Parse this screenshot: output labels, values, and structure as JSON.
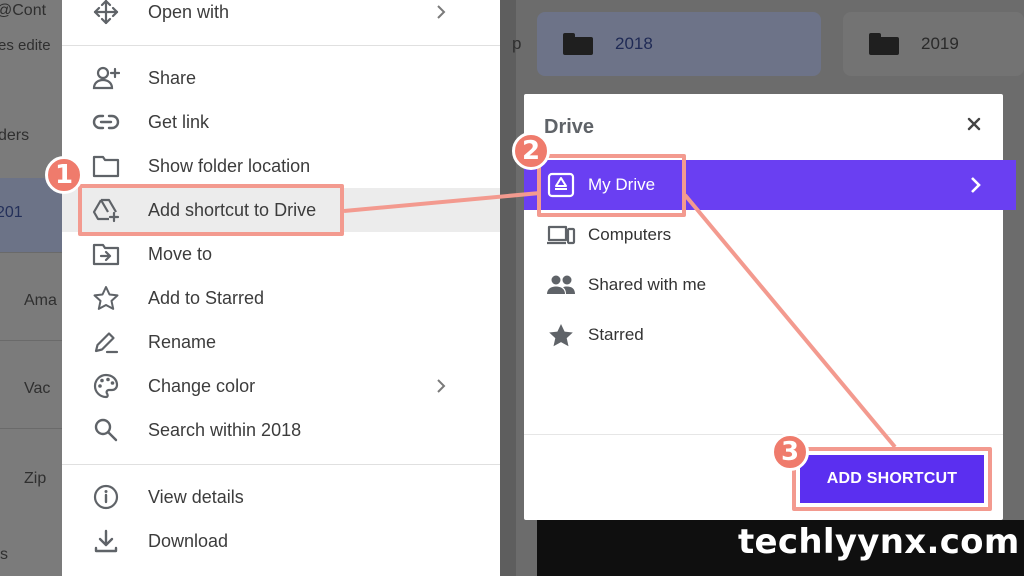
{
  "background": {
    "left_fragments": [
      {
        "name": "owner-fragment",
        "text": "@Cont"
      },
      {
        "name": "edited-fragment",
        "text": "es edite"
      },
      {
        "name": "folders-fragment",
        "text": "ders"
      },
      {
        "name": "folder-2018-fragment",
        "text": "201"
      },
      {
        "name": "folder-ama-fragment",
        "text": "Ama"
      },
      {
        "name": "folder-vac-fragment",
        "text": "Vac"
      },
      {
        "name": "folder-zip-fragment",
        "text": "Zip"
      },
      {
        "name": "bottom-fragment",
        "text": "s"
      }
    ],
    "cards": [
      {
        "label": "2018"
      },
      {
        "label": "2019"
      }
    ],
    "top_fragment": "p"
  },
  "context_menu": {
    "items": [
      {
        "label": "Open with",
        "icon": "move-arrows-icon",
        "submenu": true
      },
      {
        "label": "Share",
        "icon": "person-add-icon",
        "submenu": false
      },
      {
        "label": "Get link",
        "icon": "link-icon",
        "submenu": false
      },
      {
        "label": "Show folder location",
        "icon": "folder-outline-icon",
        "submenu": false
      },
      {
        "label": "Add shortcut to Drive",
        "icon": "drive-add-icon",
        "submenu": false,
        "highlighted": true
      },
      {
        "label": "Move to",
        "icon": "move-to-icon",
        "submenu": false
      },
      {
        "label": "Add to Starred",
        "icon": "star-outline-icon",
        "submenu": false
      },
      {
        "label": "Rename",
        "icon": "pencil-icon",
        "submenu": false
      },
      {
        "label": "Change color",
        "icon": "palette-icon",
        "submenu": true
      },
      {
        "label": "Search within 2018",
        "icon": "search-icon",
        "submenu": false
      },
      {
        "label": "View details",
        "icon": "info-icon",
        "submenu": false
      },
      {
        "label": "Download",
        "icon": "download-icon",
        "submenu": false
      }
    ]
  },
  "dialog": {
    "title": "Drive",
    "close_icon": "close-icon",
    "locations": [
      {
        "label": "My Drive",
        "icon": "drive-icon",
        "selected": true
      },
      {
        "label": "Computers",
        "icon": "computers-icon",
        "selected": false
      },
      {
        "label": "Shared with me",
        "icon": "people-icon",
        "selected": false
      },
      {
        "label": "Starred",
        "icon": "star-icon",
        "selected": false
      }
    ],
    "action_label": "ADD SHORTCUT"
  },
  "steps": [
    {
      "number": "1"
    },
    {
      "number": "2"
    },
    {
      "number": "3"
    }
  ],
  "colors": {
    "accent": "#6a3ff2",
    "button": "#5b2ff0",
    "annotation": "#f39a8f",
    "badge": "#ef7b6c"
  },
  "watermark": "techlyynx.com"
}
